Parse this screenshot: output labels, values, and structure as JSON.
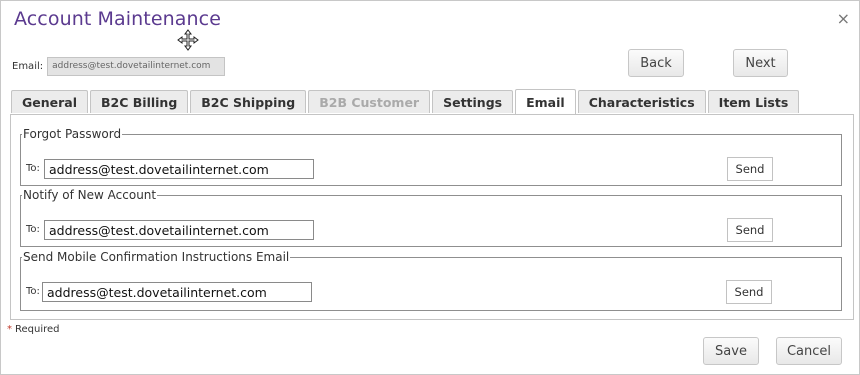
{
  "dialog": {
    "title": "Account Maintenance",
    "close_glyph": "×",
    "email_label": "Email:",
    "email_value": "address@test.dovetailinternet.com",
    "back_label": "Back",
    "next_label": "Next"
  },
  "tabs": [
    {
      "label": "General",
      "state": "normal"
    },
    {
      "label": "B2C Billing",
      "state": "normal"
    },
    {
      "label": "B2C Shipping",
      "state": "normal"
    },
    {
      "label": "B2B Customer",
      "state": "disabled"
    },
    {
      "label": "Settings",
      "state": "normal"
    },
    {
      "label": "Email",
      "state": "active"
    },
    {
      "label": "Characteristics",
      "state": "normal"
    },
    {
      "label": "Item Lists",
      "state": "normal"
    }
  ],
  "sections": [
    {
      "legend": "Forgot Password",
      "to_label": "To:",
      "to_value": "address@test.dovetailinternet.com",
      "send_label": "Send"
    },
    {
      "legend": "Notify of New Account",
      "to_label": "To:",
      "to_value": "address@test.dovetailinternet.com",
      "send_label": "Send"
    },
    {
      "legend": "Send Mobile Confirmation Instructions Email",
      "to_label": "To:",
      "to_value": "address@test.dovetailinternet.com",
      "send_label": "Send"
    }
  ],
  "footer": {
    "required_marker": "*",
    "required_text": "Required",
    "save_label": "Save",
    "cancel_label": "Cancel"
  },
  "colors": {
    "title": "#5b3a8f",
    "required_marker": "#c0392b"
  },
  "icons": {
    "cursor": "move-cursor-icon",
    "close": "close-icon"
  }
}
